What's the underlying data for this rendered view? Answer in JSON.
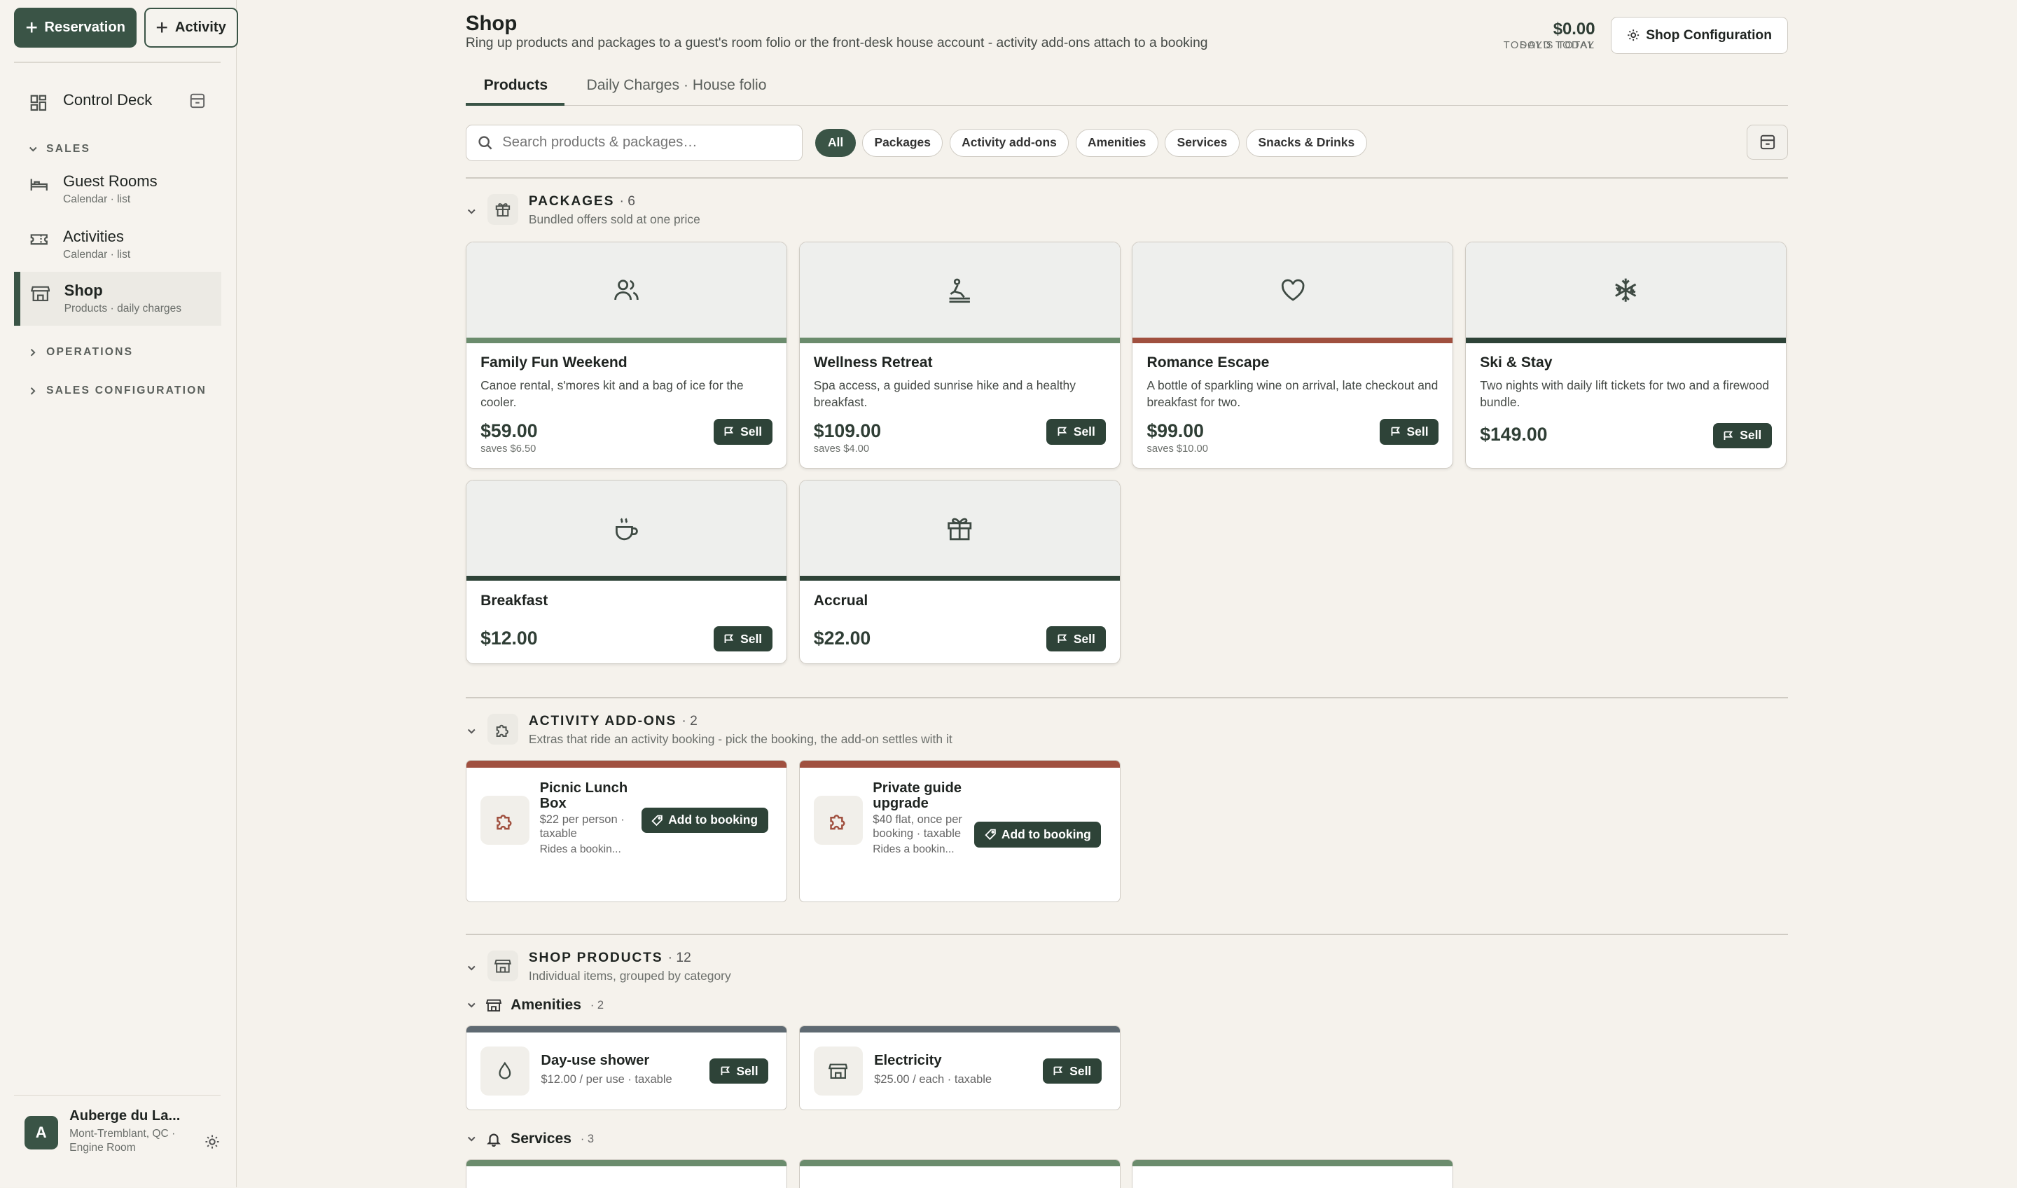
{
  "sidebar": {
    "reservation_btn": "Reservation",
    "activity_btn": "Activity",
    "control_deck": "Control Deck",
    "sales_heading": "SALES",
    "guest_rooms": {
      "label": "Guest Rooms",
      "sub": "Calendar · list"
    },
    "activities": {
      "label": "Activities",
      "sub": "Calendar · list"
    },
    "shop": {
      "label": "Shop",
      "sub": "Products · daily charges"
    },
    "operations_heading": "OPERATIONS",
    "sales_config_heading": "SALES CONFIGURATION",
    "org": {
      "initial": "A",
      "name": "Auberge du La...",
      "sub1": "Mont-Tremblant, QC ·",
      "sub2": "Engine Room"
    }
  },
  "header": {
    "title": "Shop",
    "subtitle": "Ring up products and packages to a guest's room folio or the front-desk house account - activity add-ons attach to a booking",
    "sold_today_value": "0",
    "sold_today_label": "SOLD TODAY",
    "total_value": "$0.00",
    "total_label": "TODAY'S TOTAL",
    "config_btn": "Shop Configuration"
  },
  "tabs": [
    {
      "label": "Products",
      "active": true
    },
    {
      "label": "Daily Charges · House folio",
      "active": false
    }
  ],
  "search": {
    "placeholder": "Search products & packages…"
  },
  "filters": [
    "All",
    "Packages",
    "Activity add-ons",
    "Amenities",
    "Services",
    "Snacks & Drinks"
  ],
  "sell_label": "Sell",
  "packages": {
    "title": "PACKAGES",
    "count": "· 6",
    "sub": "Bundled offers sold at one price",
    "items": [
      {
        "name": "Family Fun Weekend",
        "desc": "Canoe rental, s'mores kit and a bag of ice for the cooler.",
        "price": "$59.00",
        "saves": "saves $6.50",
        "icon": "users-icon",
        "color": "#6b8c6d"
      },
      {
        "name": "Wellness Retreat",
        "desc": "Spa access, a guided sunrise hike and a healthy breakfast.",
        "price": "$109.00",
        "saves": "saves $4.00",
        "icon": "spa-icon",
        "color": "#6b8c6d"
      },
      {
        "name": "Romance Escape",
        "desc": "A bottle of sparkling wine on arrival, late checkout and breakfast for two.",
        "price": "$99.00",
        "saves": "saves $10.00",
        "icon": "heart-icon",
        "color": "#a0503f"
      },
      {
        "name": "Ski & Stay",
        "desc": "Two nights with daily lift tickets for two and a firewood bundle.",
        "price": "$149.00",
        "saves": "",
        "icon": "snowflake-icon",
        "color": "#2e4338"
      },
      {
        "name": "Breakfast",
        "desc": "",
        "price": "$12.00",
        "saves": "",
        "icon": "coffee-icon",
        "color": "#2e4338"
      },
      {
        "name": "Accrual",
        "desc": "",
        "price": "$22.00",
        "saves": "",
        "icon": "gift-icon",
        "color": "#2e4338"
      }
    ]
  },
  "addons": {
    "title": "ACTIVITY ADD-ONS",
    "count": "· 2",
    "sub": "Extras that ride an activity booking - pick the booking, the add-on settles with it",
    "btn": "Add to booking",
    "items": [
      {
        "name": "Picnic Lunch Box",
        "meta": "$22 per person · taxable",
        "ride": "Rides a bookin..."
      },
      {
        "name": "Private guide upgrade",
        "meta": "$40 flat, once per booking · taxable",
        "ride": "Rides a bookin..."
      }
    ]
  },
  "products": {
    "title": "SHOP PRODUCTS",
    "count": "· 12",
    "sub": "Individual items, grouped by category",
    "amenities": {
      "label": "Amenities",
      "count": "· 2"
    },
    "services": {
      "label": "Services",
      "count": "· 3"
    },
    "items": [
      {
        "name": "Day-use shower",
        "meta": "$12.00 / per use · taxable"
      },
      {
        "name": "Electricity",
        "meta": "$25.00 / each · taxable"
      }
    ]
  }
}
